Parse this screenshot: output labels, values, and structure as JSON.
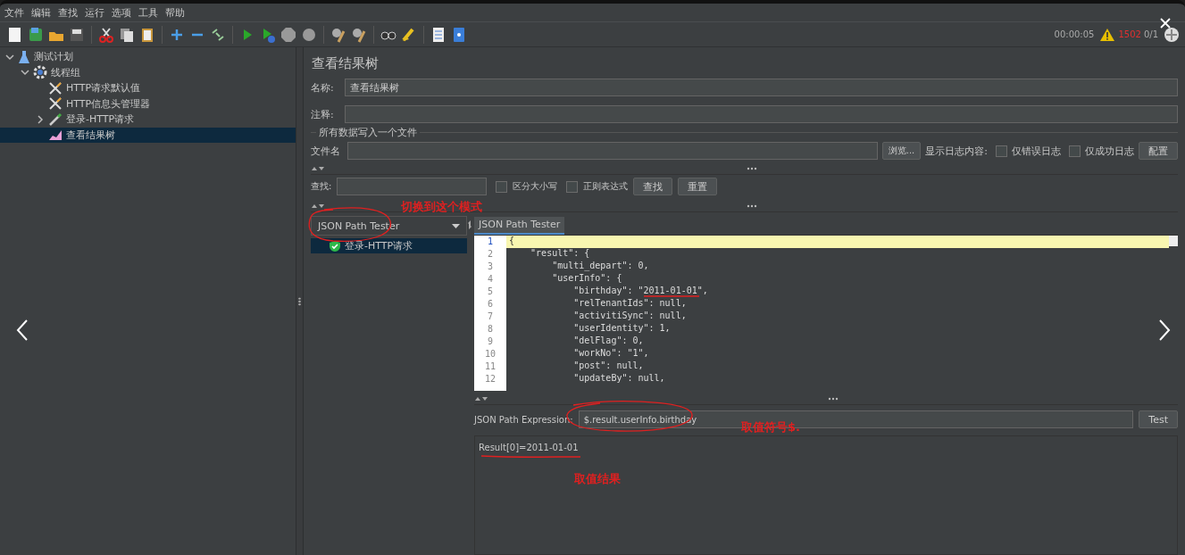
{
  "menu": [
    "文件",
    "编辑",
    "查找",
    "运行",
    "选项",
    "工具",
    "帮助"
  ],
  "status": {
    "elapsed": "00:00:05",
    "errors": "1502",
    "threads": "0/1"
  },
  "tree": [
    {
      "label": "测试计划",
      "kind": "plan",
      "expanded": true,
      "selected": false,
      "children": [
        {
          "label": "线程组",
          "kind": "group",
          "expanded": true,
          "selected": false,
          "children": [
            {
              "label": "HTTP请求默认值",
              "kind": "config",
              "selected": false
            },
            {
              "label": "HTTP信息头管理器",
              "kind": "config",
              "selected": false
            },
            {
              "label": "登录-HTTP请求",
              "kind": "sampler",
              "expanded": false,
              "selected": false
            },
            {
              "label": "查看结果树",
              "kind": "listener",
              "selected": true
            }
          ]
        }
      ]
    }
  ],
  "panel": {
    "title": "查看结果树",
    "name_label": "名称:",
    "name_value": "查看结果树",
    "comment_label": "注释:",
    "file_group": "所有数据写入一个文件",
    "file_label": "文件名",
    "browse": "浏览...",
    "log_label": "显示日志内容:",
    "log_options": [
      {
        "label": "仅错误日志",
        "checked": false
      },
      {
        "label": "仅成功日志",
        "checked": false
      }
    ],
    "configure": "配置"
  },
  "search": {
    "label": "查找:",
    "options": [
      {
        "label": "区分大小写",
        "checked": false
      },
      {
        "label": "正则表达式",
        "checked": false
      }
    ],
    "find": "查找",
    "reset": "重置"
  },
  "renderer": {
    "value": "JSON Path Tester"
  },
  "results": [
    {
      "label": "登录-HTTP请求",
      "success": true,
      "selected": true
    }
  ],
  "tab": {
    "label": "JSON Path Tester",
    "selected": true
  },
  "code_lines": [
    {
      "number": "1",
      "text": "{",
      "highlighted": true
    },
    {
      "number": "2",
      "text": "    \"result\": {",
      "highlighted": false
    },
    {
      "number": "3",
      "text": "        \"multi_depart\": 0,",
      "highlighted": false
    },
    {
      "number": "4",
      "text": "        \"userInfo\": {",
      "highlighted": false
    },
    {
      "number": "5",
      "text": "            \"birthday\": \"2011-01-01\",",
      "highlighted": false
    },
    {
      "number": "6",
      "text": "            \"relTenantIds\": null,",
      "highlighted": false
    },
    {
      "number": "7",
      "text": "            \"activitiSync\": null,",
      "highlighted": false
    },
    {
      "number": "8",
      "text": "            \"userIdentity\": 1,",
      "highlighted": false
    },
    {
      "number": "9",
      "text": "            \"delFlag\": 0,",
      "highlighted": false
    },
    {
      "number": "10",
      "text": "            \"workNo\": \"1\",",
      "highlighted": false
    },
    {
      "number": "11",
      "text": "            \"post\": null,",
      "highlighted": false
    },
    {
      "number": "12",
      "text": "            \"updateBy\": null,",
      "highlighted": false
    }
  ],
  "expression": {
    "label": "JSON Path Expression:",
    "value": "$.result.userInfo.birthday",
    "button": "Test"
  },
  "result_text": "Result[0]=2011-01-01",
  "annotations": [
    "切换到这个模式",
    "取值符号$.",
    "取值结果"
  ]
}
